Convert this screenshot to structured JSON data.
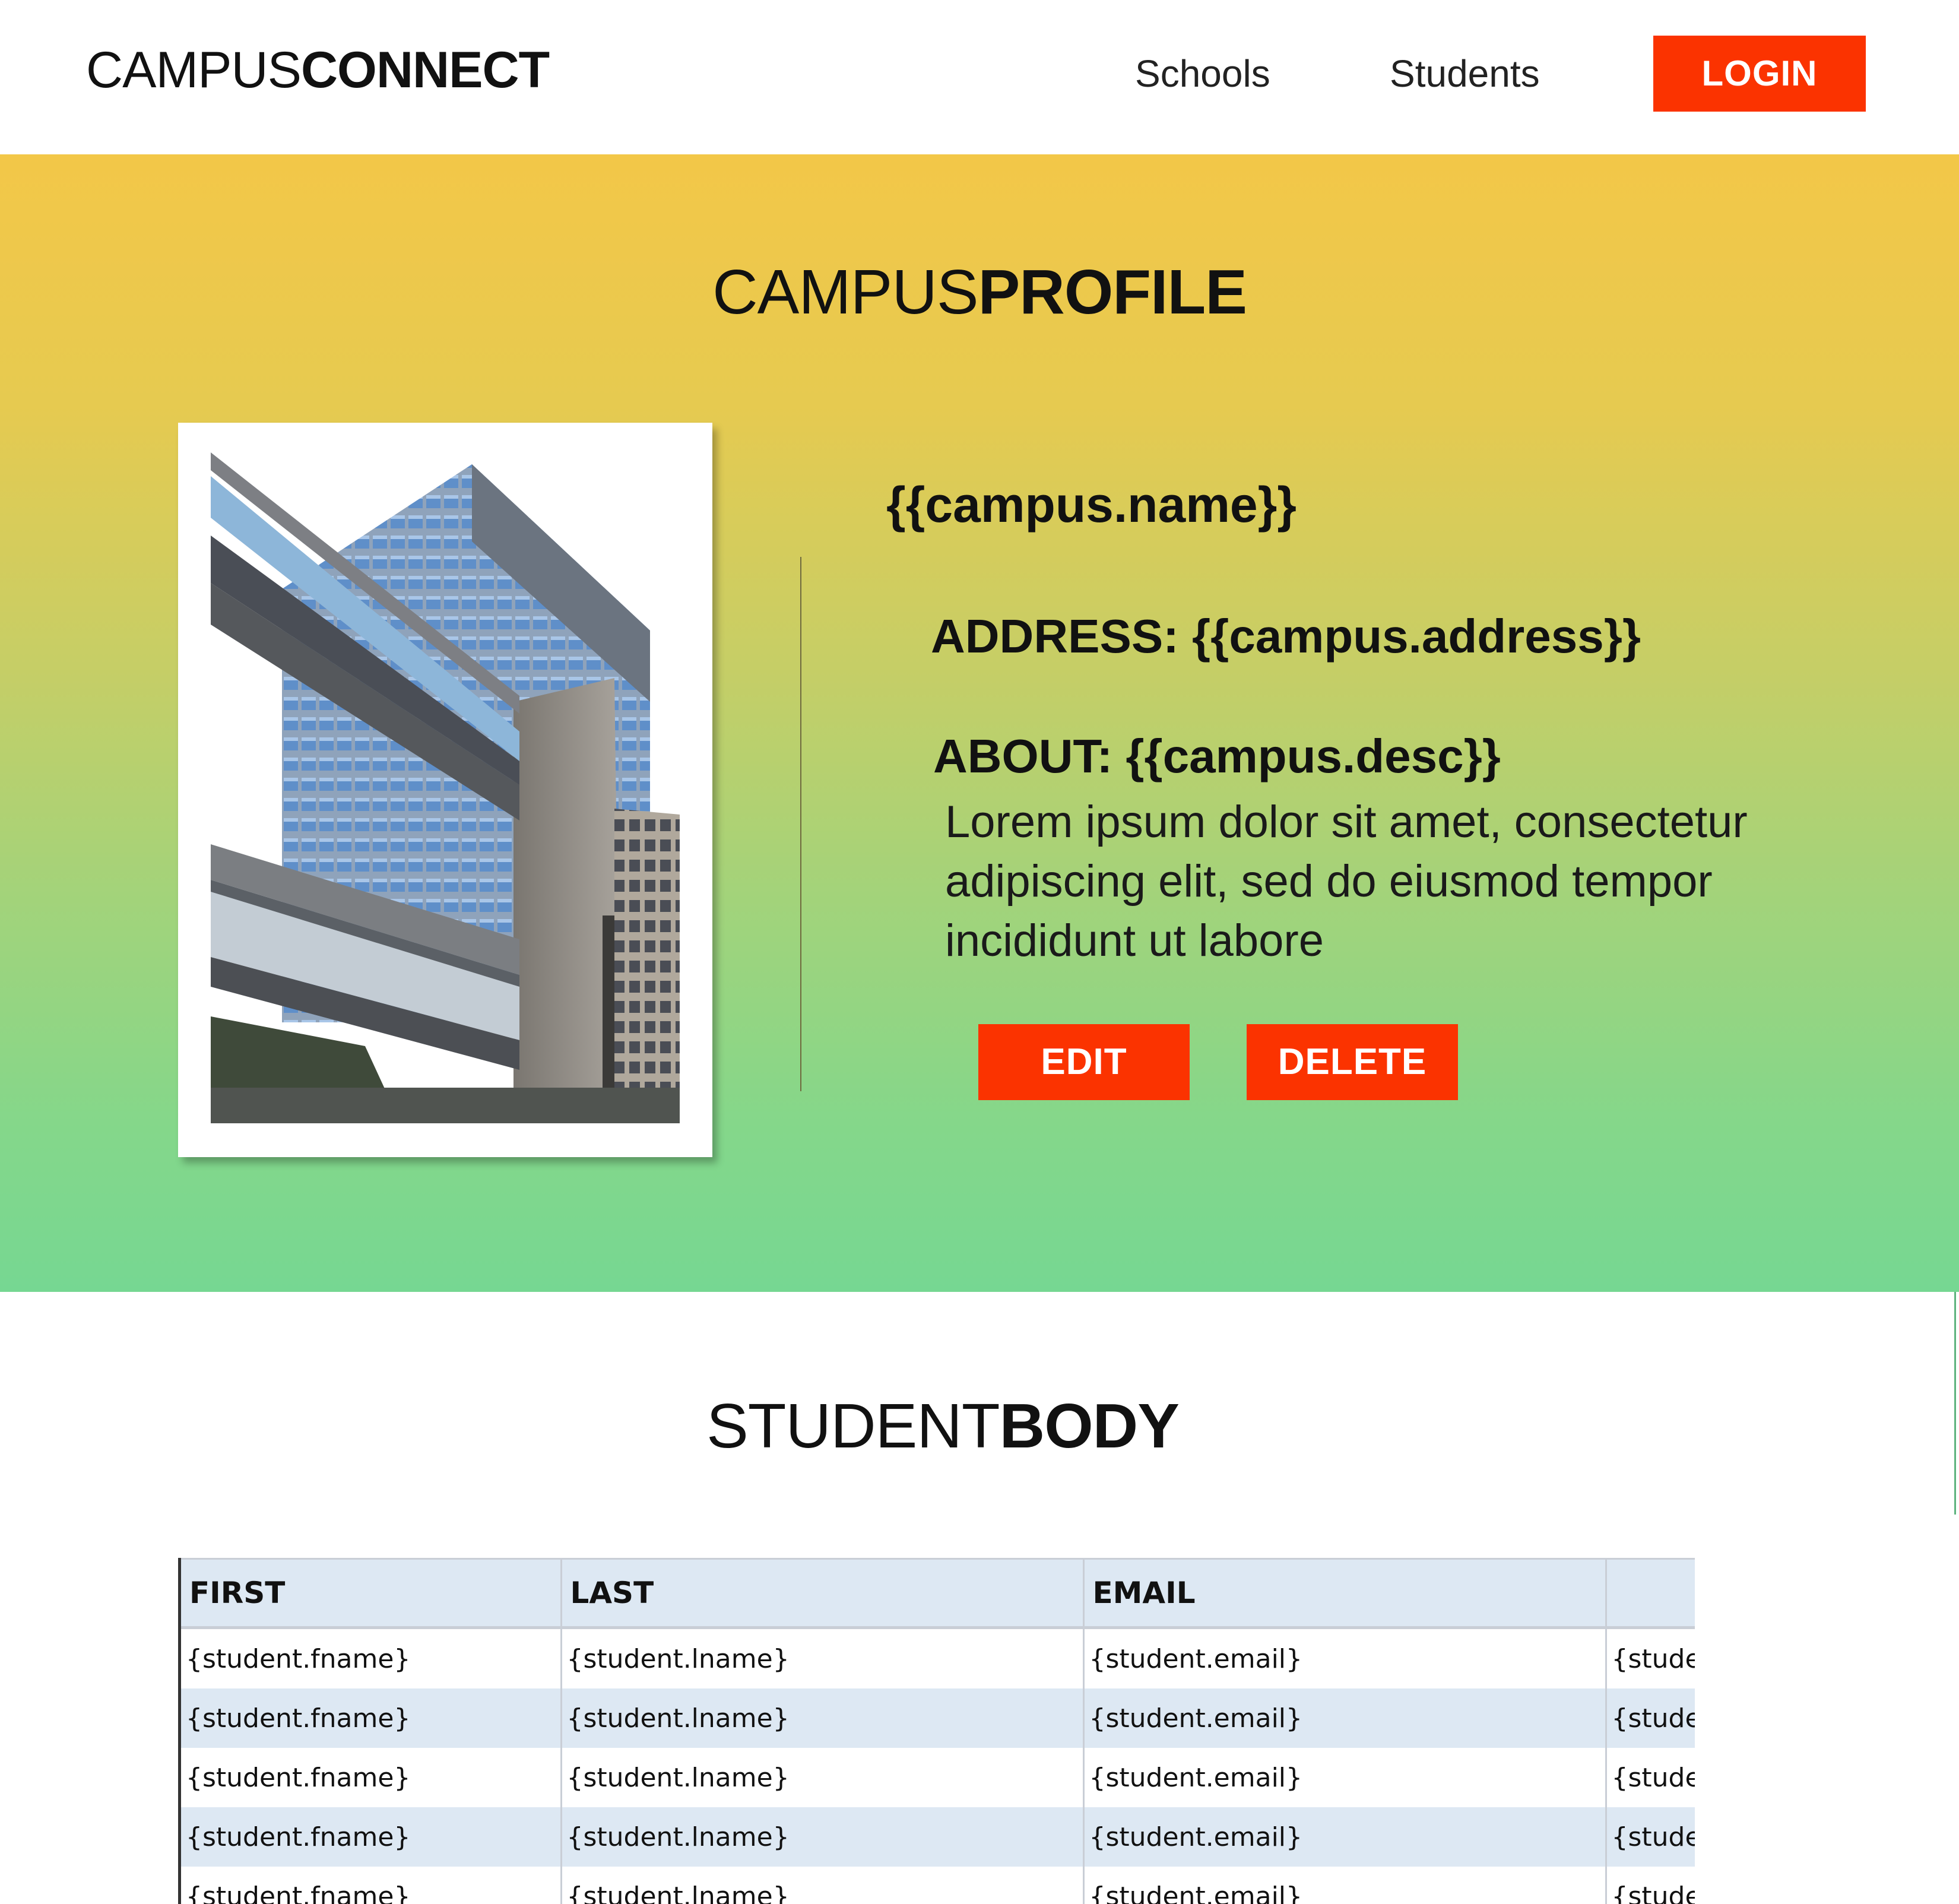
{
  "navbar": {
    "brand_light": "CAMPUS",
    "brand_bold": "CONNECT",
    "links": [
      "Schools",
      "Students"
    ],
    "login_label": "LOGIN"
  },
  "profile": {
    "title_light": "CAMPUS",
    "title_bold": "PROFILE",
    "campus_name": "{{campus.name}}",
    "address_label": "ADDRESS:",
    "address_value": "{{campus.address}}",
    "about_label": "ABOUT:",
    "about_value": "{{campus.desc}}",
    "description": "Lorem ipsum dolor sit amet, consectetur adipiscing elit, sed do eiusmod tempor incididunt ut labore",
    "edit_label": "EDIT",
    "delete_label": "DELETE"
  },
  "students": {
    "title_light": "STUDENT",
    "title_bold": "BODY",
    "columns": [
      "FIRST",
      "LAST",
      "EMAIL",
      ""
    ],
    "rows": [
      [
        "{student.fname}",
        "{student.lname}",
        "{student.email}",
        "{student"
      ],
      [
        "{student.fname}",
        "{student.lname}",
        "{student.email}",
        "{student"
      ],
      [
        "{student.fname}",
        "{student.lname}",
        "{student.email}",
        "{student"
      ],
      [
        "{student.fname}",
        "{student.lname}",
        "{student.email}",
        "{student"
      ],
      [
        "{student.fname}",
        "{student.lname}",
        "{student.email}",
        "{student"
      ]
    ]
  },
  "colors": {
    "accent": "#fb3300",
    "gradient_top": "#f3c748",
    "gradient_bottom": "#76d792",
    "table_stripe": "#dde8f3"
  }
}
